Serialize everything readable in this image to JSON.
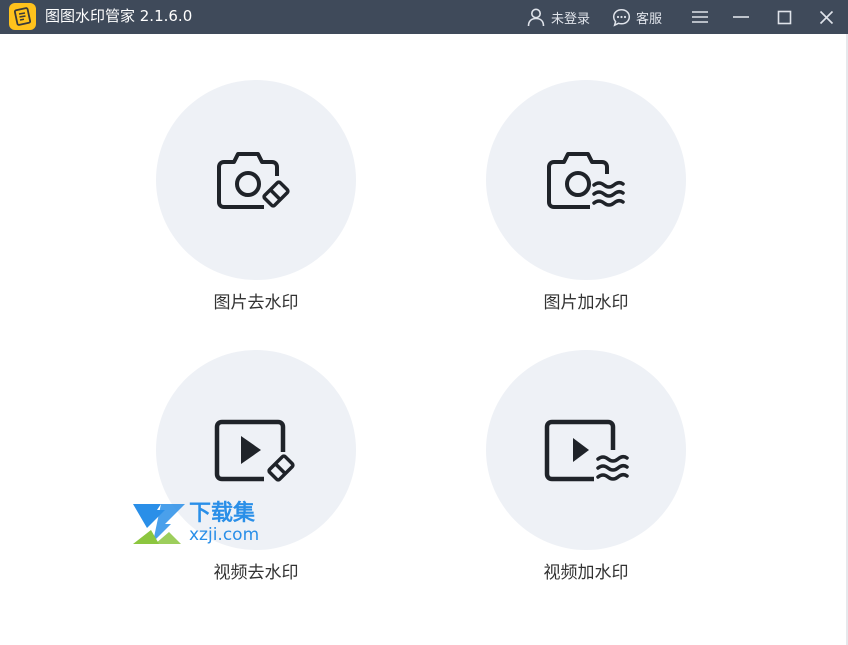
{
  "app": {
    "title": "图图水印管家  2.1.6.0",
    "logo_icon": "app-logo-icon"
  },
  "titlebar": {
    "login_label": "未登录",
    "service_label": "客服",
    "icons": [
      "user-icon",
      "chat-icon",
      "menu-icon",
      "minimize-icon",
      "maximize-icon",
      "close-icon"
    ]
  },
  "features": [
    {
      "label": "图片去水印",
      "icon": "camera-eraser-icon"
    },
    {
      "label": "图片加水印",
      "icon": "camera-watermark-icon"
    },
    {
      "label": "视频去水印",
      "icon": "video-eraser-icon"
    },
    {
      "label": "视频加水印",
      "icon": "video-watermark-icon"
    }
  ],
  "watermark": {
    "cn": "下载集",
    "en": "xzji.com"
  },
  "colors": {
    "titlebar": "#3f4a5a",
    "circle": "#eef1f6",
    "icon": "#1f2329",
    "logo": "#ffc21c",
    "watermark_blue": "#2a8fe8",
    "watermark_green": "#8cc63f"
  }
}
